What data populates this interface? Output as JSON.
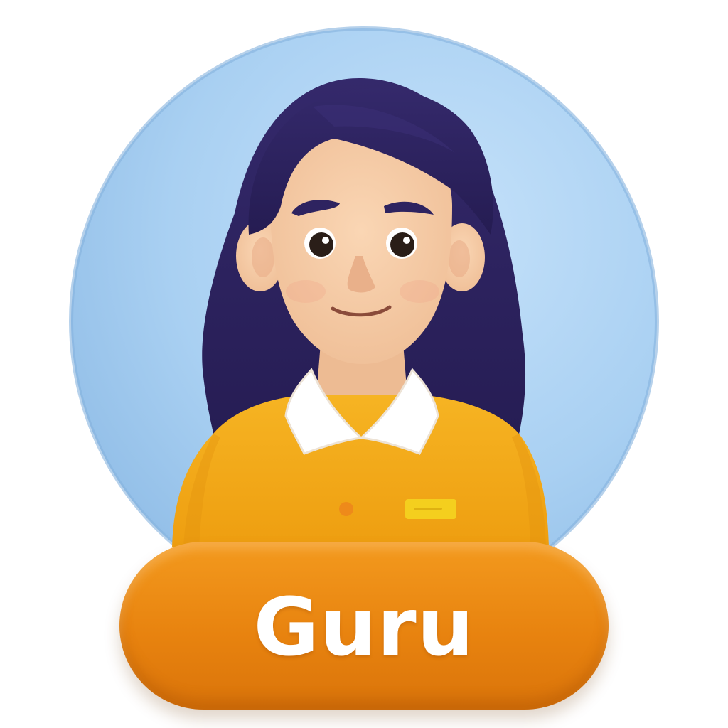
{
  "badge": {
    "name": "Guru"
  },
  "colors": {
    "background_circle": "#A9D0F2",
    "hair": "#2E2360",
    "skin": "#F6CCA8",
    "sweater": "#F2A91A",
    "collar": "#FFFFFF",
    "name_tag": "#F4CF1E",
    "button_dot": "#EE8A1A",
    "pill": "#E8830F",
    "pill_text": "#FFFFFF"
  },
  "icons": {
    "avatar": "woman-avatar-illustration"
  }
}
